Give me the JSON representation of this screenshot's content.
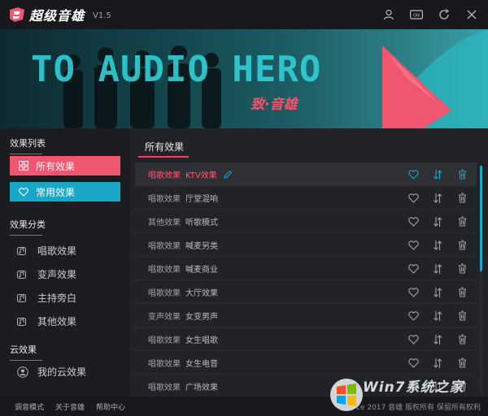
{
  "app": {
    "title": "超级音雄",
    "version": "V1.5"
  },
  "window_controls": [
    "user-icon",
    "toggle-icon",
    "refresh-icon",
    "close-icon"
  ],
  "banner": {
    "headline": "TO AUDIO HERO",
    "sub": "致·音雄"
  },
  "sidebar": {
    "effect_list_heading": "效果列表",
    "all_effects": "所有效果",
    "common_effects": "常用效果",
    "category_heading": "效果分类",
    "categories": [
      {
        "label": "唱歌效果",
        "icon": "music-note-icon"
      },
      {
        "label": "变声效果",
        "icon": "music-note-icon"
      },
      {
        "label": "主持旁白",
        "icon": "music-note-icon"
      },
      {
        "label": "其他效果",
        "icon": "music-note-icon"
      }
    ],
    "cloud_heading": "云效果",
    "my_cloud": "我的云效果"
  },
  "main": {
    "tab": "所有效果",
    "rows": [
      {
        "cat": "唱歌效果",
        "name": "KTV效果",
        "active": true
      },
      {
        "cat": "唱歌效果",
        "name": "厅堂混响",
        "active": false
      },
      {
        "cat": "其他效果",
        "name": "听歌模式",
        "active": false
      },
      {
        "cat": "唱歌效果",
        "name": "喊麦另类",
        "active": false
      },
      {
        "cat": "唱歌效果",
        "name": "喊麦商业",
        "active": false
      },
      {
        "cat": "唱歌效果",
        "name": "大厅效果",
        "active": false
      },
      {
        "cat": "变声效果",
        "name": "女变男声",
        "active": false
      },
      {
        "cat": "唱歌效果",
        "name": "女生唱歌",
        "active": false
      },
      {
        "cat": "唱歌效果",
        "name": "女生电音",
        "active": false
      },
      {
        "cat": "唱歌效果",
        "name": "广场效果",
        "active": false
      }
    ]
  },
  "footer": {
    "links": [
      "调音模式",
      "关于音雄",
      "帮助中心"
    ],
    "copyright": "ce 2017 音雄 版权所有 保留所有权利"
  },
  "watermark": {
    "text": "Win7系统之家"
  },
  "colors": {
    "accent_pink": "#f0566f",
    "accent_cyan": "#1aa6c6",
    "background": "#1a1b1f"
  }
}
